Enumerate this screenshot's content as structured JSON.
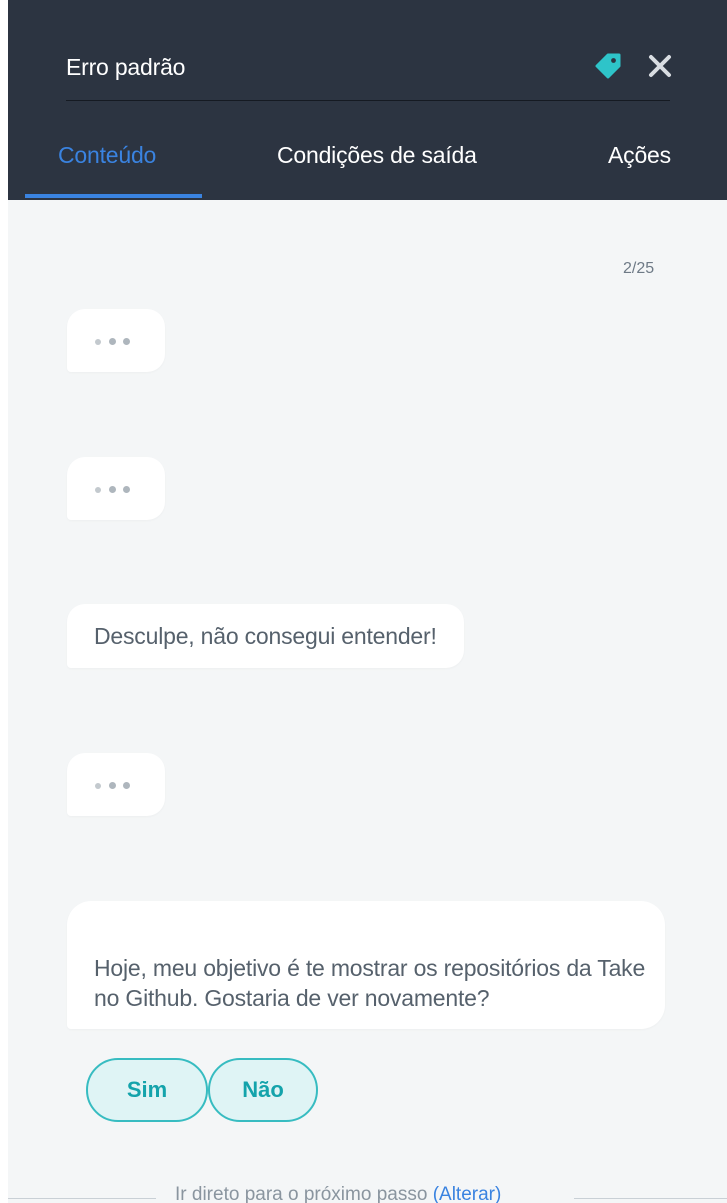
{
  "header": {
    "title": "Erro padrão",
    "icons": [
      "tag-icon",
      "close-icon"
    ],
    "tabs": [
      {
        "label": "Conteúdo",
        "active": true
      },
      {
        "label": "Condições de saída",
        "active": false
      },
      {
        "label": "Ações",
        "active": false
      }
    ]
  },
  "content": {
    "counter": "2/25",
    "messages": [
      {
        "type": "typing"
      },
      {
        "type": "typing"
      },
      {
        "type": "text",
        "text": "Desculpe, não consegui entender!"
      },
      {
        "type": "typing"
      },
      {
        "type": "text",
        "text": "Hoje, meu objetivo é te mostrar os repositórios da Take no Github. Gostaria de ver novamente?"
      }
    ],
    "quick_replies": [
      "Sim",
      "Não"
    ]
  },
  "footer": {
    "prefix": "Ir direto para o próximo passo",
    "link_label": "(Alterar)"
  },
  "colors": {
    "header_bg": "#2c3441",
    "accent": "#3a83e0",
    "tag_icon": "#2ec4c9",
    "quick_reply_border": "#37bcc1",
    "quick_reply_text": "#14a3ab",
    "content_bg": "#f4f6f7"
  }
}
